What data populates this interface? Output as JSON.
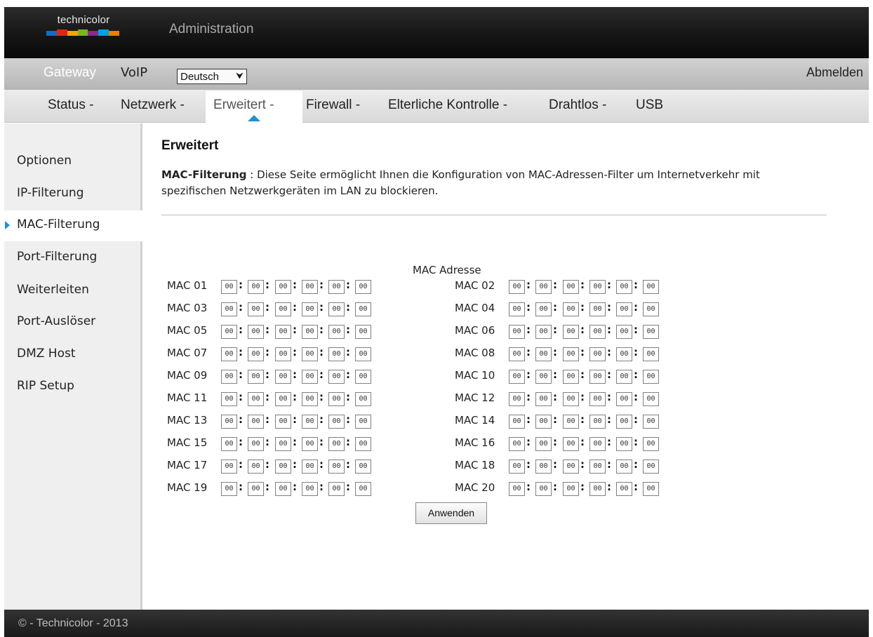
{
  "header": {
    "brand": "technicolor",
    "title": "Administration",
    "brand_colors": [
      "#0b6fc7",
      "#e2231a",
      "#f7a600",
      "#7ab51d",
      "#8e2a8a",
      "#00a3e0",
      "#ee7d00"
    ]
  },
  "topnav": {
    "gateway": "Gateway",
    "voip": "VoIP",
    "language": "Deutsch",
    "logout": "Abmelden"
  },
  "tabs": [
    {
      "label": "Status -"
    },
    {
      "label": "Netzwerk -"
    },
    {
      "label": "Erweitert -",
      "active": true
    },
    {
      "label": "Firewall -"
    },
    {
      "label": "Elterliche Kontrolle -"
    },
    {
      "label": "Drahtlos -"
    },
    {
      "label": "USB"
    }
  ],
  "sidebar": {
    "items": [
      {
        "label": "Optionen"
      },
      {
        "label": "IP-Filterung"
      },
      {
        "label": "MAC-Filterung",
        "active": true
      },
      {
        "label": "Port-Filterung"
      },
      {
        "label": "Weiterleiten"
      },
      {
        "label": "Port-Auslöser"
      },
      {
        "label": "DMZ Host"
      },
      {
        "label": "RIP Setup"
      }
    ]
  },
  "main": {
    "title": "Erweitert",
    "desc_bold": "MAC-Filterung",
    "desc_rest": " : Diese Seite ermöglicht Ihnen die Konfiguration von MAC-Adressen-Filter um Internetverkehr mit spezifischen Netzwerkgeräten im LAN zu blockieren.",
    "mac_header": "MAC Adresse",
    "macs": [
      {
        "label": "MAC 01",
        "octets": [
          "00",
          "00",
          "00",
          "00",
          "00",
          "00"
        ]
      },
      {
        "label": "MAC 02",
        "octets": [
          "00",
          "00",
          "00",
          "00",
          "00",
          "00"
        ]
      },
      {
        "label": "MAC 03",
        "octets": [
          "00",
          "00",
          "00",
          "00",
          "00",
          "00"
        ]
      },
      {
        "label": "MAC 04",
        "octets": [
          "00",
          "00",
          "00",
          "00",
          "00",
          "00"
        ]
      },
      {
        "label": "MAC 05",
        "octets": [
          "00",
          "00",
          "00",
          "00",
          "00",
          "00"
        ]
      },
      {
        "label": "MAC 06",
        "octets": [
          "00",
          "00",
          "00",
          "00",
          "00",
          "00"
        ]
      },
      {
        "label": "MAC 07",
        "octets": [
          "00",
          "00",
          "00",
          "00",
          "00",
          "00"
        ]
      },
      {
        "label": "MAC 08",
        "octets": [
          "00",
          "00",
          "00",
          "00",
          "00",
          "00"
        ]
      },
      {
        "label": "MAC 09",
        "octets": [
          "00",
          "00",
          "00",
          "00",
          "00",
          "00"
        ]
      },
      {
        "label": "MAC 10",
        "octets": [
          "00",
          "00",
          "00",
          "00",
          "00",
          "00"
        ]
      },
      {
        "label": "MAC 11",
        "octets": [
          "00",
          "00",
          "00",
          "00",
          "00",
          "00"
        ]
      },
      {
        "label": "MAC 12",
        "octets": [
          "00",
          "00",
          "00",
          "00",
          "00",
          "00"
        ]
      },
      {
        "label": "MAC 13",
        "octets": [
          "00",
          "00",
          "00",
          "00",
          "00",
          "00"
        ]
      },
      {
        "label": "MAC 14",
        "octets": [
          "00",
          "00",
          "00",
          "00",
          "00",
          "00"
        ]
      },
      {
        "label": "MAC 15",
        "octets": [
          "00",
          "00",
          "00",
          "00",
          "00",
          "00"
        ]
      },
      {
        "label": "MAC 16",
        "octets": [
          "00",
          "00",
          "00",
          "00",
          "00",
          "00"
        ]
      },
      {
        "label": "MAC 17",
        "octets": [
          "00",
          "00",
          "00",
          "00",
          "00",
          "00"
        ]
      },
      {
        "label": "MAC 18",
        "octets": [
          "00",
          "00",
          "00",
          "00",
          "00",
          "00"
        ]
      },
      {
        "label": "MAC 19",
        "octets": [
          "00",
          "00",
          "00",
          "00",
          "00",
          "00"
        ]
      },
      {
        "label": "MAC 20",
        "octets": [
          "00",
          "00",
          "00",
          "00",
          "00",
          "00"
        ]
      }
    ],
    "apply_label": "Anwenden"
  },
  "footer": {
    "text": "© - Technicolor - 2013"
  },
  "colors": {
    "accent": "#1e90d6"
  }
}
